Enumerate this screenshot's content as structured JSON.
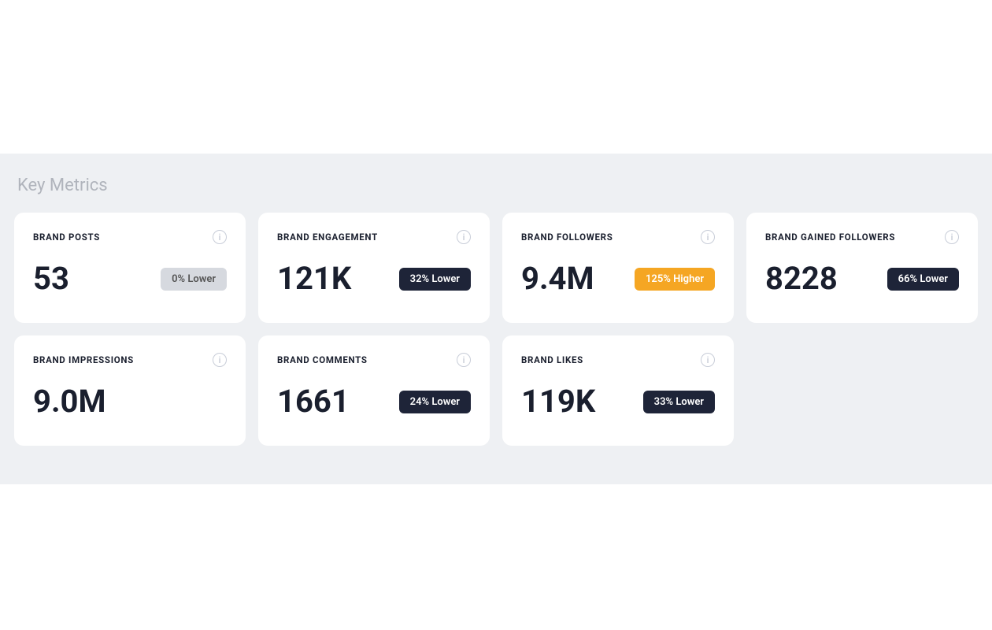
{
  "page": {
    "section_title": "Key Metrics"
  },
  "cards": [
    {
      "id": "brand-posts",
      "label": "BRAND POSTS",
      "value": "53",
      "badge_text": "0% Lower",
      "badge_type": "badge-gray",
      "row": 1
    },
    {
      "id": "brand-engagement",
      "label": "BRAND ENGAGEMENT",
      "value": "121K",
      "badge_text": "32% Lower",
      "badge_type": "badge-dark",
      "row": 1
    },
    {
      "id": "brand-followers",
      "label": "BRAND FOLLOWERS",
      "value": "9.4M",
      "badge_text": "125% Higher",
      "badge_type": "badge-orange",
      "row": 1
    },
    {
      "id": "brand-gained-followers",
      "label": "BRAND GAINED FOLLOWERS",
      "value": "8228",
      "badge_text": "66% Lower",
      "badge_type": "badge-dark",
      "row": 1
    },
    {
      "id": "brand-impressions",
      "label": "BRAND IMPRESSIONS",
      "value": "9.0M",
      "badge_text": null,
      "badge_type": null,
      "row": 2
    },
    {
      "id": "brand-comments",
      "label": "BRAND COMMENTS",
      "value": "1661",
      "badge_text": "24% Lower",
      "badge_type": "badge-dark",
      "row": 2
    },
    {
      "id": "brand-likes",
      "label": "BRAND LIKES",
      "value": "119K",
      "badge_text": "33% Lower",
      "badge_type": "badge-dark",
      "row": 2
    }
  ],
  "icons": {
    "info": "i"
  }
}
